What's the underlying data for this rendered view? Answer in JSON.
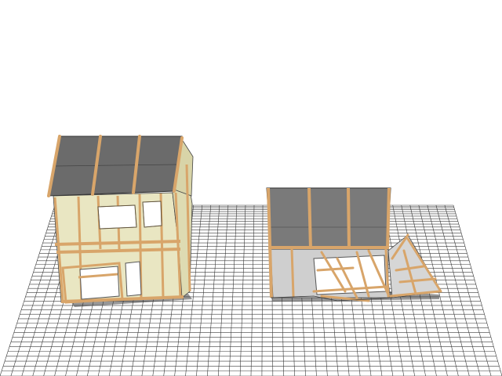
{
  "scene": {
    "background_color": "#ffffff",
    "ground": {
      "type": "perspective-grid",
      "line_color": "#3a3a3a",
      "surface_color": "#ffffff"
    },
    "houses": [
      {
        "id": "left",
        "state": "two-storey frame, partial wall damage",
        "wall_color": "#e9e6c2",
        "roof_color": "#6b6b6b",
        "timber_color": "#d8a56a"
      },
      {
        "id": "right",
        "state": "single-storey frame, collapsed walls",
        "wall_color": "#cfcfcf",
        "roof_color": "#7a7a7a",
        "timber_color": "#d8a56a"
      }
    ]
  }
}
